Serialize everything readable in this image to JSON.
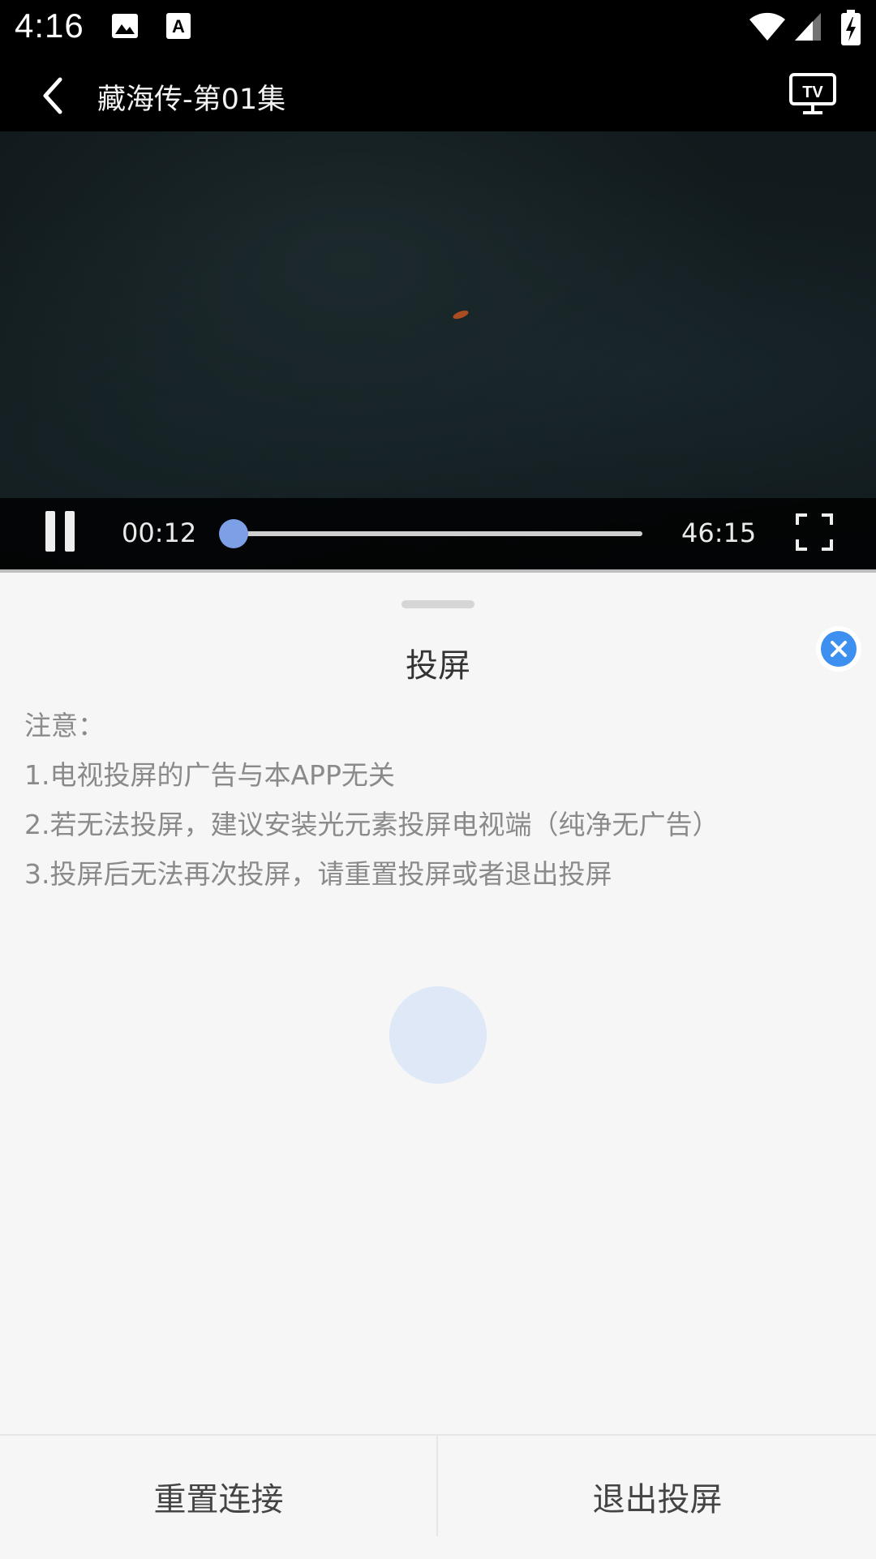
{
  "status_bar": {
    "time": "4:16",
    "icons": [
      "image-icon",
      "text-a-icon",
      "wifi-icon",
      "signal-icon",
      "battery-charging-icon"
    ]
  },
  "app_bar": {
    "title": "藏海传-第01集",
    "back_icon": "chevron-left-icon",
    "cast_icon": "tv-icon",
    "cast_label": "TV"
  },
  "player": {
    "current_time": "00:12",
    "total_time": "46:15",
    "progress": 0.004,
    "pause_icon": "pause-icon",
    "fullscreen_icon": "fullscreen-icon"
  },
  "cast_sheet": {
    "title": "投屏",
    "close_icon": "close-icon",
    "notice_lines": [
      "注意：",
      "1.电视投屏的广告与本APP无关",
      "2.若无法投屏，建议安装光元素投屏电视端（纯净无广告）",
      "3.投屏后无法再次投屏，请重置投屏或者退出投屏"
    ],
    "reset_label": "重置连接",
    "exit_label": "退出投屏"
  },
  "colors": {
    "accent": "#3d8ff0",
    "seek_thumb": "#7d9fe6",
    "sheet_background": "#f6f6f6"
  }
}
